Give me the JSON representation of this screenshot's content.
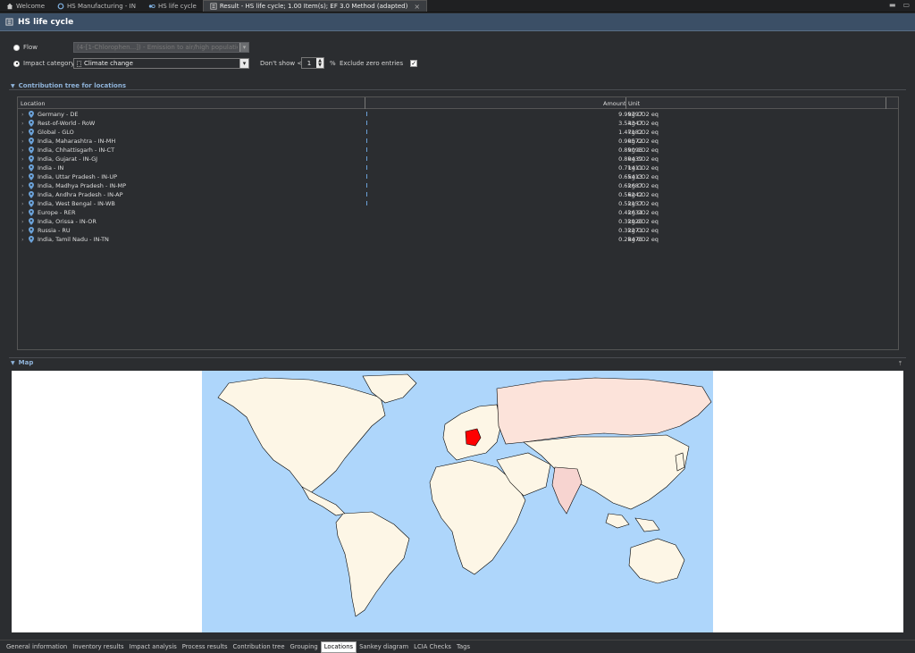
{
  "editor_tabs": [
    {
      "label": "Welcome",
      "icon": "home-icon",
      "active": false
    },
    {
      "label": "HS Manufacturing - IN",
      "icon": "process-icon",
      "active": false
    },
    {
      "label": "HS life cycle",
      "icon": "product-system-icon",
      "active": false
    },
    {
      "label": "Result - HS life cycle; 1.00 Item(s); EF 3.0 Method (adapted)",
      "icon": "result-icon",
      "active": true
    }
  ],
  "header": {
    "title": "HS life cycle"
  },
  "controls": {
    "flow_label": "Flow",
    "flow_value": "(4-[1-Chlorophen...]) - Emission to air/high population density",
    "impact_label": "Impact category",
    "impact_value": "Climate change",
    "dont_show_label": "Don't show <",
    "dont_show_value": "1",
    "percent_label": "%",
    "exclude_zero_label": "Exclude zero entries",
    "exclude_zero_checked": true
  },
  "contribution_section": {
    "title": "Contribution tree for locations",
    "columns": {
      "location": "Location",
      "amount": "Amount",
      "unit": "Unit"
    },
    "rows": [
      {
        "location": "Germany - DE",
        "amount": "9.99797",
        "unit": "kg CO2 eq"
      },
      {
        "location": "Rest-of-World - RoW",
        "amount": "3.54347",
        "unit": "kg CO2 eq"
      },
      {
        "location": "Global - GLO",
        "amount": "1.47182",
        "unit": "kg CO2 eq"
      },
      {
        "location": "India, Maharashtra - IN-MH",
        "amount": "0.90572",
        "unit": "kg CO2 eq"
      },
      {
        "location": "India, Chhattisgarh - IN-CT",
        "amount": "0.89096",
        "unit": "kg CO2 eq"
      },
      {
        "location": "India, Gujarat - IN-GJ",
        "amount": "0.80439",
        "unit": "kg CO2 eq"
      },
      {
        "location": "India - IN",
        "amount": "0.71411",
        "unit": "kg CO2 eq"
      },
      {
        "location": "India, Uttar Pradesh - IN-UP",
        "amount": "0.65413",
        "unit": "kg CO2 eq"
      },
      {
        "location": "India, Madhya Pradesh - IN-MP",
        "amount": "0.62687",
        "unit": "kg CO2 eq"
      },
      {
        "location": "India, Andhra Pradesh - IN-AP",
        "amount": "0.56242",
        "unit": "kg CO2 eq"
      },
      {
        "location": "India, West Bengal - IN-WB",
        "amount": "0.52157",
        "unit": "kg CO2 eq"
      },
      {
        "location": "Europe - RER",
        "amount": "0.42634",
        "unit": "kg CO2 eq"
      },
      {
        "location": "India, Orissa - IN-OR",
        "amount": "0.32926",
        "unit": "kg CO2 eq"
      },
      {
        "location": "Russia - RU",
        "amount": "0.32271",
        "unit": "kg CO2 eq"
      },
      {
        "location": "India, Tamil Nadu - IN-TN",
        "amount": "0.28476",
        "unit": "kg CO2 eq"
      }
    ]
  },
  "map_section": {
    "title": "Map"
  },
  "bottom_tabs": [
    {
      "label": "General information",
      "active": false
    },
    {
      "label": "Inventory results",
      "active": false
    },
    {
      "label": "Impact analysis",
      "active": false
    },
    {
      "label": "Process results",
      "active": false
    },
    {
      "label": "Contribution tree",
      "active": false
    },
    {
      "label": "Grouping",
      "active": false
    },
    {
      "label": "Locations",
      "active": true
    },
    {
      "label": "Sankey diagram",
      "active": false
    },
    {
      "label": "LCIA Checks",
      "active": false
    },
    {
      "label": "Tags",
      "active": false
    }
  ],
  "colors": {
    "header_bg": "#3b4f66",
    "ocean": "#aed6fb",
    "land": "#fdf6e6",
    "highlight": "#ff0000",
    "accent": "#8fb3d9"
  }
}
